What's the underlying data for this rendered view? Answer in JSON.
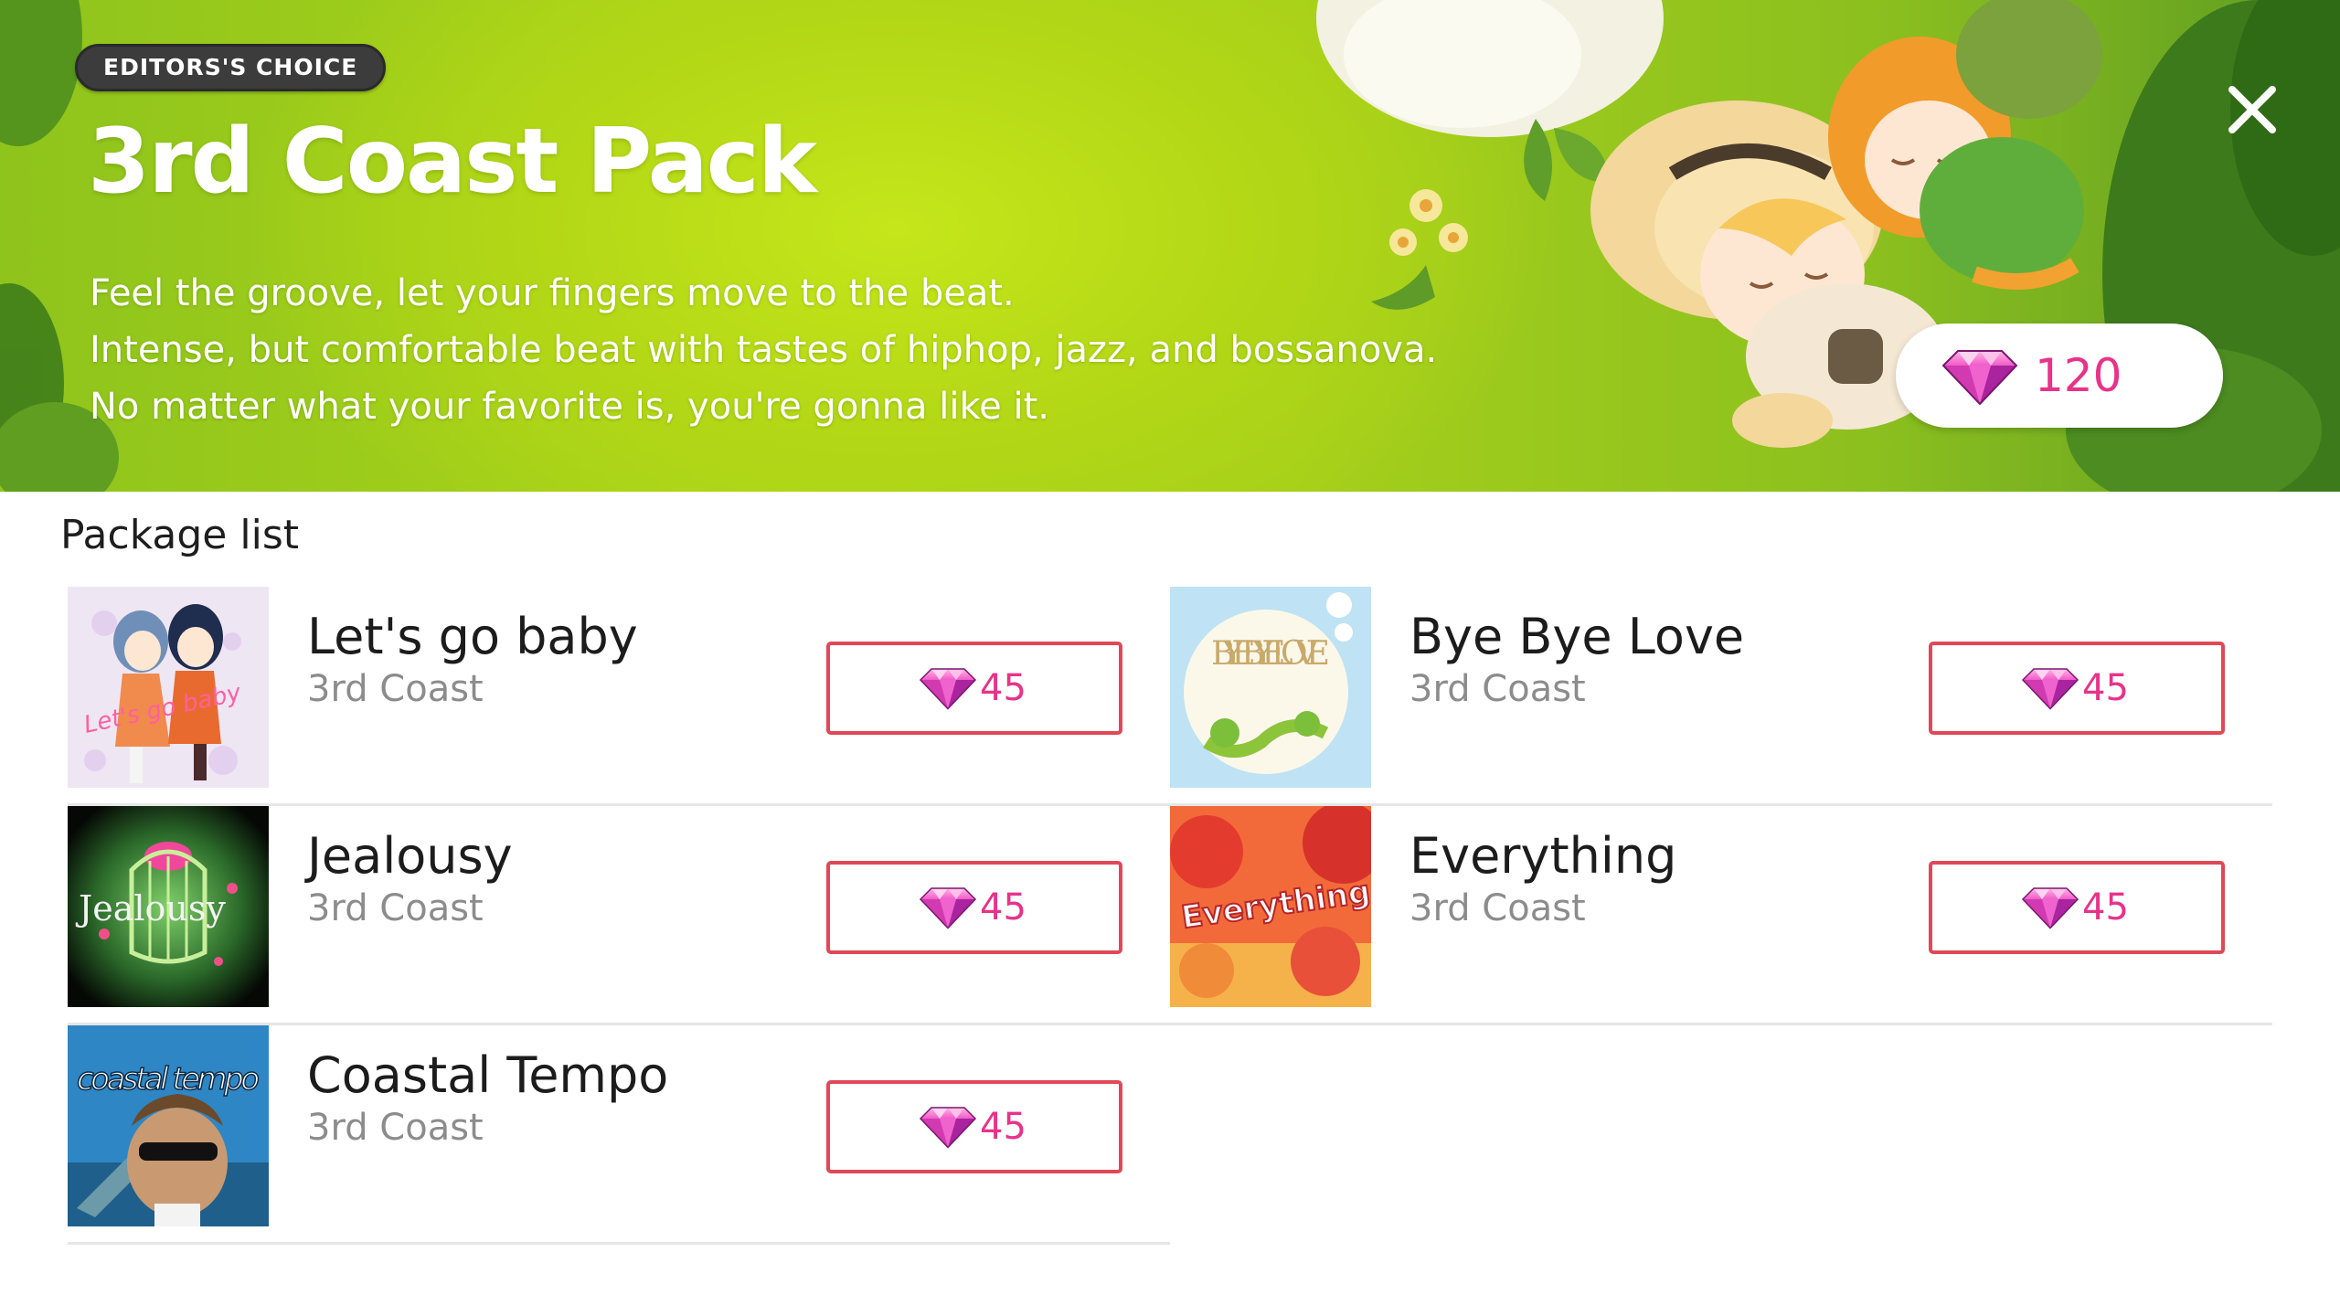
{
  "banner": {
    "badge": "EDITORS'S CHOICE",
    "title": "3rd Coast Pack",
    "description": [
      "Feel the groove, let your fingers move to the beat.",
      "Intense, but comfortable beat with tastes of hiphop, jazz, and bossanova.",
      "No matter what your favorite is, you're gonna like it."
    ],
    "price": "120",
    "price_icon": "gem-icon",
    "close_icon": "close-icon"
  },
  "package_list": {
    "title": "Package list",
    "items": [
      {
        "title": "Let's go baby",
        "artist": "3rd Coast",
        "price": "45",
        "cover_text": "Let's go baby"
      },
      {
        "title": "Bye Bye Love",
        "artist": "3rd Coast",
        "price": "45",
        "cover_text": "BYE BYE LOVE"
      },
      {
        "title": "Jealousy",
        "artist": "3rd Coast",
        "price": "45",
        "cover_text": "Jealousy"
      },
      {
        "title": "Everything",
        "artist": "3rd Coast",
        "price": "45",
        "cover_text": "Everything"
      },
      {
        "title": "Coastal Tempo",
        "artist": "3rd Coast",
        "price": "45",
        "cover_text": "coastal tempo"
      }
    ]
  },
  "colors": {
    "accent_pink": "#e8338a",
    "button_border": "#e04857",
    "banner_green": "#a9d31a"
  }
}
